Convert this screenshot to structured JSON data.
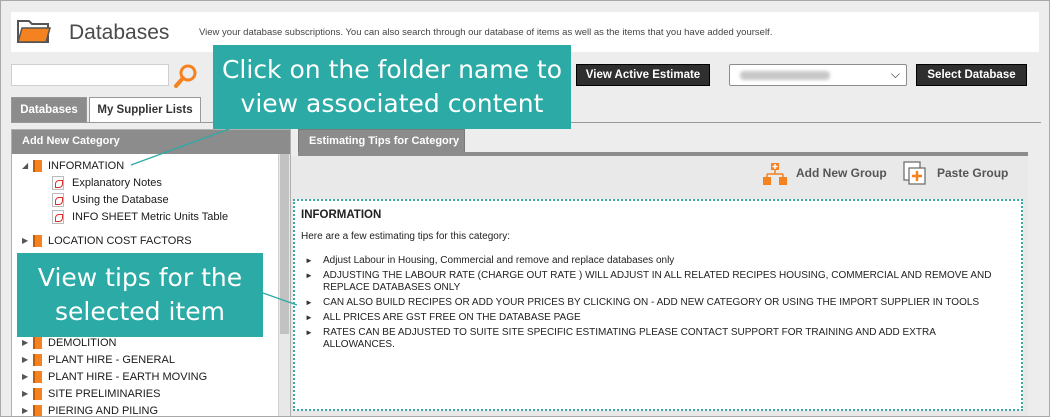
{
  "header": {
    "title": "Databases",
    "description": "View your database subscriptions. You can also search through our database of items as well as the items that you have added yourself."
  },
  "toolbar": {
    "search_value": "",
    "view_estimate_label": "View Active Estimate",
    "select_database_label": "Select Database"
  },
  "tabs": [
    {
      "label": "Databases",
      "active": true
    },
    {
      "label": "My Supplier Lists",
      "active": false
    }
  ],
  "left_panel": {
    "header": "Add New Category",
    "tree": [
      {
        "label": "INFORMATION",
        "expanded": true,
        "children": [
          "Explanatory Notes",
          "Using the Database",
          "INFO SHEET Metric Units Table"
        ]
      },
      {
        "label": "LOCATION COST FACTORS",
        "expanded": false
      },
      {
        "label": "DEMOLITION",
        "expanded": false
      },
      {
        "label": "PLANT HIRE - GENERAL",
        "expanded": false
      },
      {
        "label": "PLANT HIRE - EARTH MOVING",
        "expanded": false
      },
      {
        "label": "SITE PRELIMINARIES",
        "expanded": false
      },
      {
        "label": "PIERING AND PILING",
        "expanded": false
      }
    ]
  },
  "right_panel": {
    "tab_label": "Estimating Tips for Category",
    "add_group_label": "Add New Group",
    "paste_group_label": "Paste Group",
    "tips_title": "INFORMATION",
    "tips_intro": "Here are a few estimating tips for this category:",
    "tips": [
      "Adjust Labour in Housing, Commercial and remove and replace databases only",
      "ADJUSTING THE LABOUR RATE (CHARGE OUT RATE ) WILL ADJUST IN ALL RELATED RECIPES HOUSING, COMMERCIAL AND REMOVE AND REPLACE DATABASES ONLY",
      "CAN ALSO BUILD RECIPES OR ADD YOUR PRICES BY CLICKING ON - ADD NEW CATEGORY OR USING THE IMPORT SUPPLIER IN TOOLS",
      "ALL PRICES ARE GST FREE ON THE DATABASE PAGE",
      "RATES CAN BE ADJUSTED TO SUITE SITE SPECIFIC ESTIMATING PLEASE CONTACT SUPPORT FOR TRAINING AND ADD EXTRA ALLOWANCES."
    ]
  },
  "callouts": {
    "folder_line1": "Click on the folder name to",
    "folder_line2": "view associated content",
    "tips_line1": "View tips for the",
    "tips_line2": "selected item"
  },
  "colors": {
    "accent_teal": "#2baaa6",
    "header_gray": "#8c8c8c",
    "folder_orange": "#f58220",
    "button_dark": "#2f2f2f"
  },
  "icons": [
    "folder-icon",
    "search-icon",
    "book-icon",
    "pdf-icon",
    "add-group-icon",
    "paste-group-icon",
    "chevron-down-icon"
  ]
}
